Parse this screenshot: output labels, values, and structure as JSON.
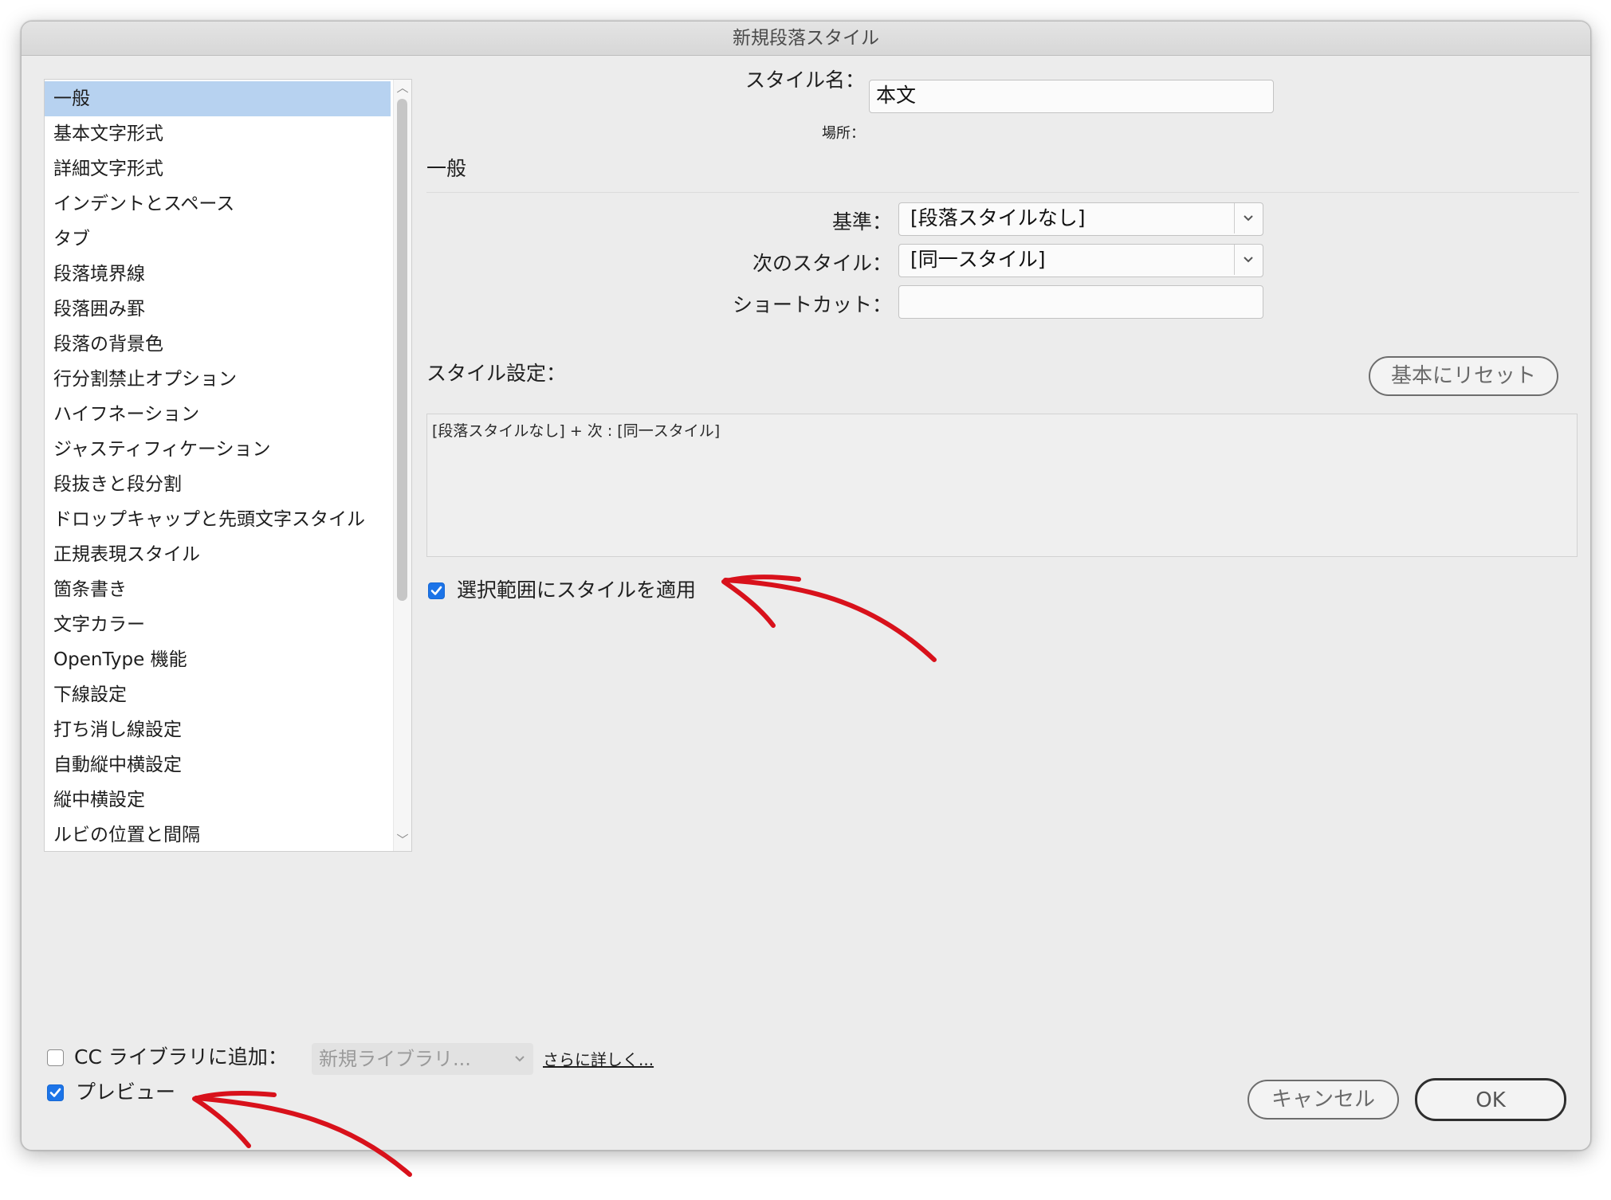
{
  "window": {
    "title": "新規段落スタイル"
  },
  "sidebar": {
    "items": [
      "一般",
      "基本文字形式",
      "詳細文字形式",
      "インデントとスペース",
      "タブ",
      "段落境界線",
      "段落囲み罫",
      "段落の背景色",
      "行分割禁止オプション",
      "ハイフネーション",
      "ジャスティフィケーション",
      "段抜きと段分割",
      "ドロップキャップと先頭文字スタイル",
      "正規表現スタイル",
      "箇条書き",
      "文字カラー",
      "OpenType 機能",
      "下線設定",
      "打ち消し線設定",
      "自動縦中横設定",
      "縦中横設定",
      "ルビの位置と間隔"
    ],
    "selected_index": 0
  },
  "main": {
    "style_name_label": "スタイル名：",
    "style_name_value": "本文",
    "location_label": "場所：",
    "section_title": "一般",
    "based_on_label": "基準：",
    "based_on_value": "[段落スタイルなし]",
    "next_style_label": "次のスタイル：",
    "next_style_value": "[同一スタイル]",
    "shortcut_label": "ショートカット：",
    "shortcut_value": "",
    "style_settings_label": "スタイル設定：",
    "reset_button": "基本にリセット",
    "style_settings_text": "[段落スタイルなし] + 次 : [同一スタイル]",
    "apply_to_selection_label": "選択範囲にスタイルを適用",
    "apply_to_selection_checked": true
  },
  "footer": {
    "cc_library_label": "CC ライブラリに追加：",
    "cc_library_checked": false,
    "library_select_value": "新規ライブラリ...",
    "learn_more_link": "さらに詳しく...",
    "preview_label": "プレビュー",
    "preview_checked": true,
    "cancel_button": "キャンセル",
    "ok_button": "OK"
  },
  "colors": {
    "selection": "#b7d2f0",
    "checkbox_accent": "#1c74e8",
    "annotation_arrow": "#d8111b"
  },
  "icons": {
    "dropdown": "chevron-down-icon",
    "checkmark": "checkmark-icon",
    "scroll_up": "scroll-up-arrow-icon",
    "scroll_down": "scroll-down-arrow-icon",
    "annotation": "red-arrow-icon"
  }
}
